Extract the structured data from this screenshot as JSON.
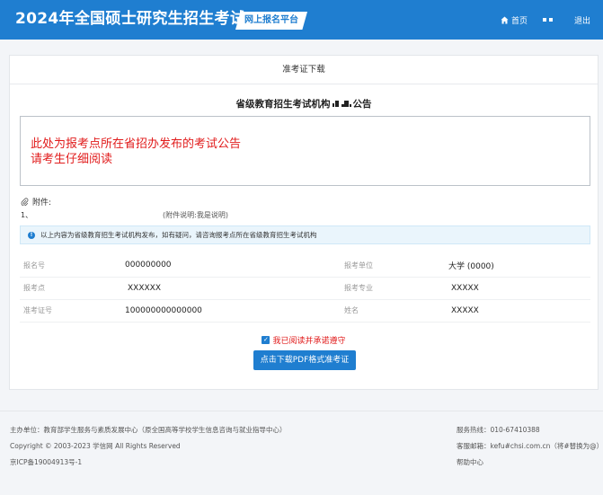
{
  "header": {
    "brand": "2024年全国硕士研究生招生考试",
    "platform": "网上报名平台",
    "nav": {
      "home": "首页",
      "logout": "退出"
    }
  },
  "card": {
    "title": "准考证下载",
    "notice_heading_prefix": "省级教育招生考试机构",
    "notice_heading_suffix": "公告",
    "notice_lines": [
      "此处为报考点所在省招办发布的考试公告",
      "请考生仔细阅读"
    ],
    "attachment_label": "附件:",
    "attachments": [
      {
        "index": "1、",
        "desc": "(附件说明:我是说明)"
      }
    ],
    "info_bar": "以上内容为省级教育招生考试机构发布，如有疑问，请咨询报考点所在省级教育招生考试机构",
    "fields": [
      {
        "label": "报名号",
        "value": "000000000",
        "label2": "报考单位",
        "value2": "大学 (0000)"
      },
      {
        "label": "报考点",
        "value": "XXXXXX",
        "label2": "报考专业",
        "value2": "XXXXX"
      },
      {
        "label": "准考证号",
        "value": "100000000000000",
        "label2": "姓名",
        "value2": "XXXXX"
      }
    ],
    "agree_text": "我已阅读并承诺遵守",
    "download_button": "点击下载PDF格式准考证"
  },
  "footer": {
    "left": [
      "主办单位：教育部学生服务与素质发展中心（原全国高等学校学生信息咨询与就业指导中心）",
      "Copyright © 2003-2023 学信网 All Rights Reserved",
      "京ICP备19004913号-1"
    ],
    "right": [
      "服务热线：010-67410388",
      "客服邮箱：kefu#chsi.com.cn（将#替换为@）",
      "帮助中心"
    ]
  },
  "colors": {
    "primary": "#1f7ed0",
    "notice_red": "#e11c1c"
  },
  "icons": [
    "home-icon",
    "attachment-icon",
    "info-icon",
    "checkbox-checked-icon"
  ]
}
